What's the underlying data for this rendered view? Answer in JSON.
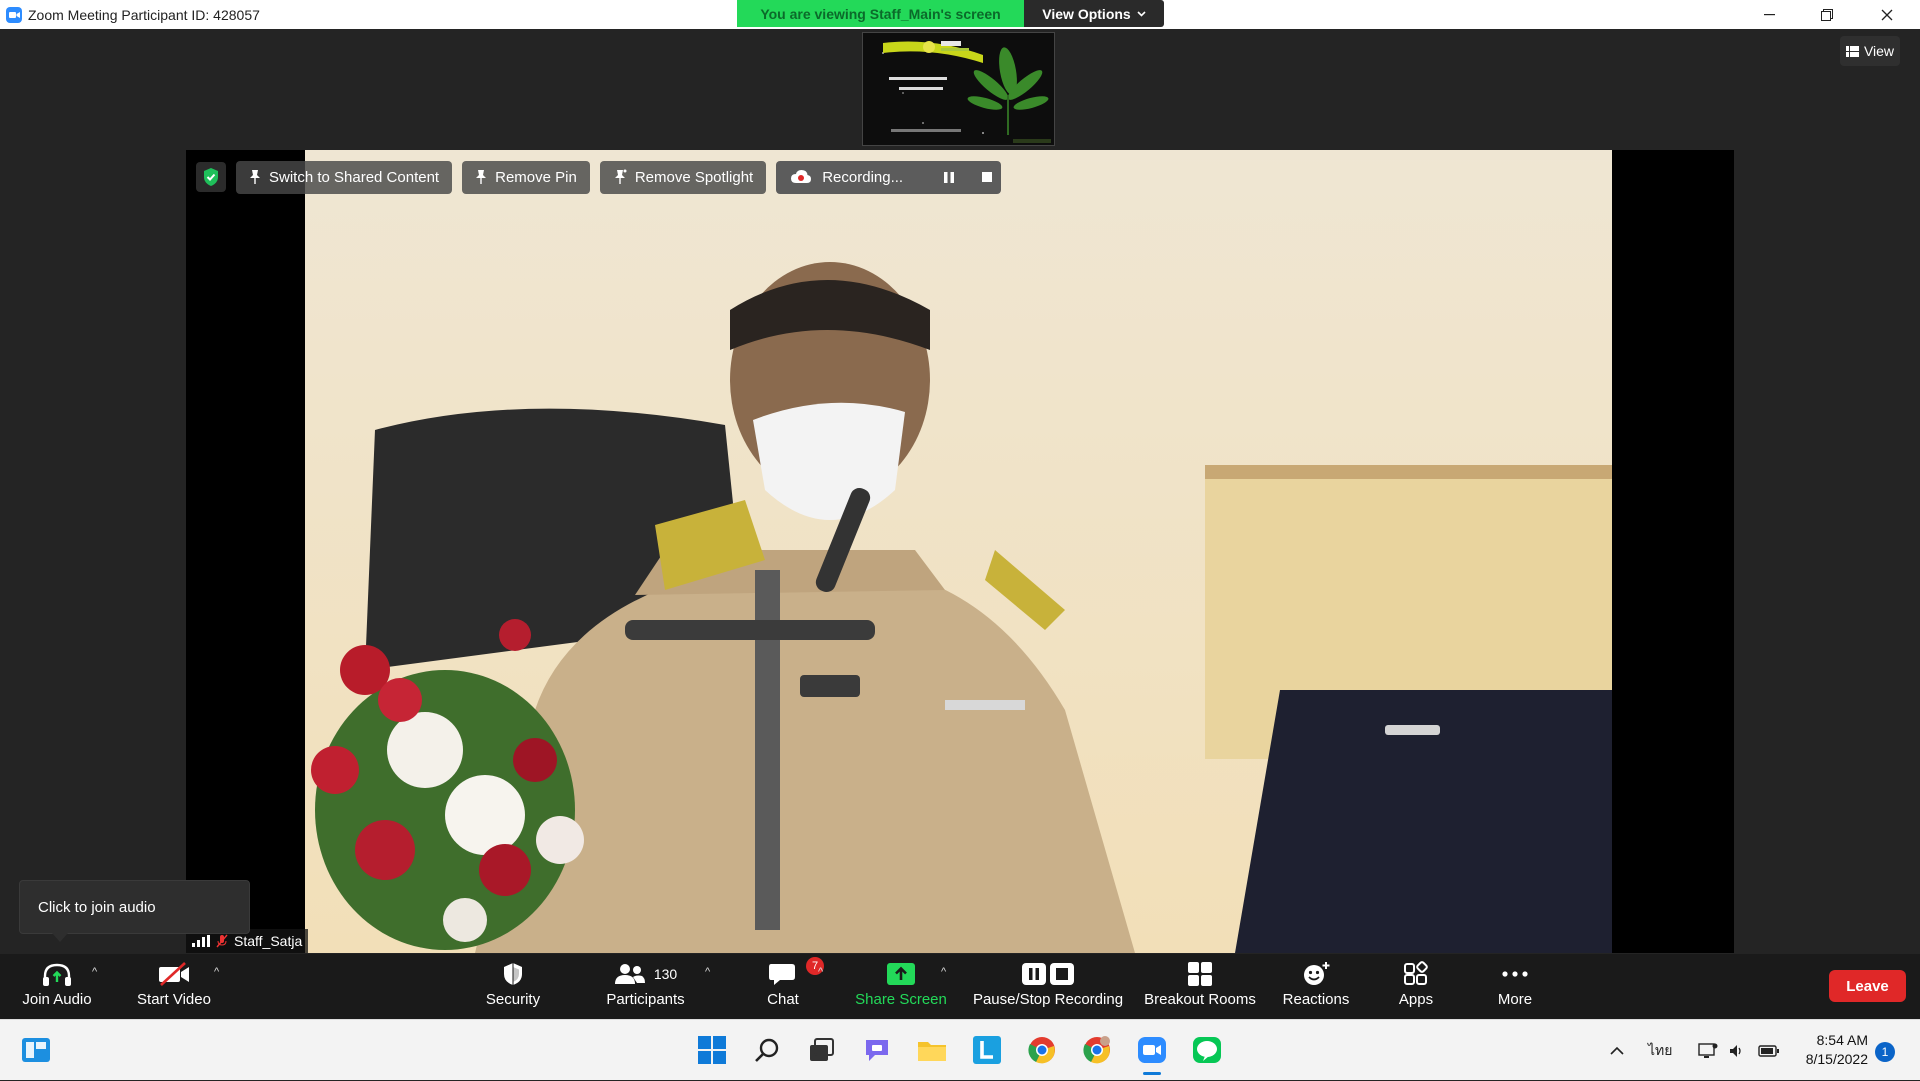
{
  "window": {
    "title": "Zoom Meeting Participant ID: 428057",
    "viewing_banner": "You are viewing Staff_Main's screen",
    "view_options_label": "View Options"
  },
  "view_button": {
    "label": "View"
  },
  "top_controls": {
    "switch_label": "Switch to Shared Content",
    "remove_pin_label": "Remove Pin",
    "remove_spotlight_label": "Remove Spotlight",
    "recording_label": "Recording..."
  },
  "participant": {
    "name": "Staff_Satja"
  },
  "tooltip": {
    "text": "Click to join audio"
  },
  "toolbar": {
    "join_audio": "Join Audio",
    "start_video": "Start Video",
    "security": "Security",
    "participants": "Participants",
    "participant_count": "130",
    "chat": "Chat",
    "chat_badge": "7",
    "share_screen": "Share Screen",
    "pause_stop_recording": "Pause/Stop Recording",
    "breakout_rooms": "Breakout Rooms",
    "reactions": "Reactions",
    "apps": "Apps",
    "more": "More",
    "leave": "Leave"
  },
  "taskbar": {
    "language": "ไทย",
    "time": "8:54 AM",
    "date": "8/15/2022",
    "notification_count": "1"
  },
  "colors": {
    "share_green": "#23d959",
    "leave_red": "#e02828",
    "toolbar_bg": "#1a1a1a",
    "zoom_blue": "#2d8cff"
  }
}
